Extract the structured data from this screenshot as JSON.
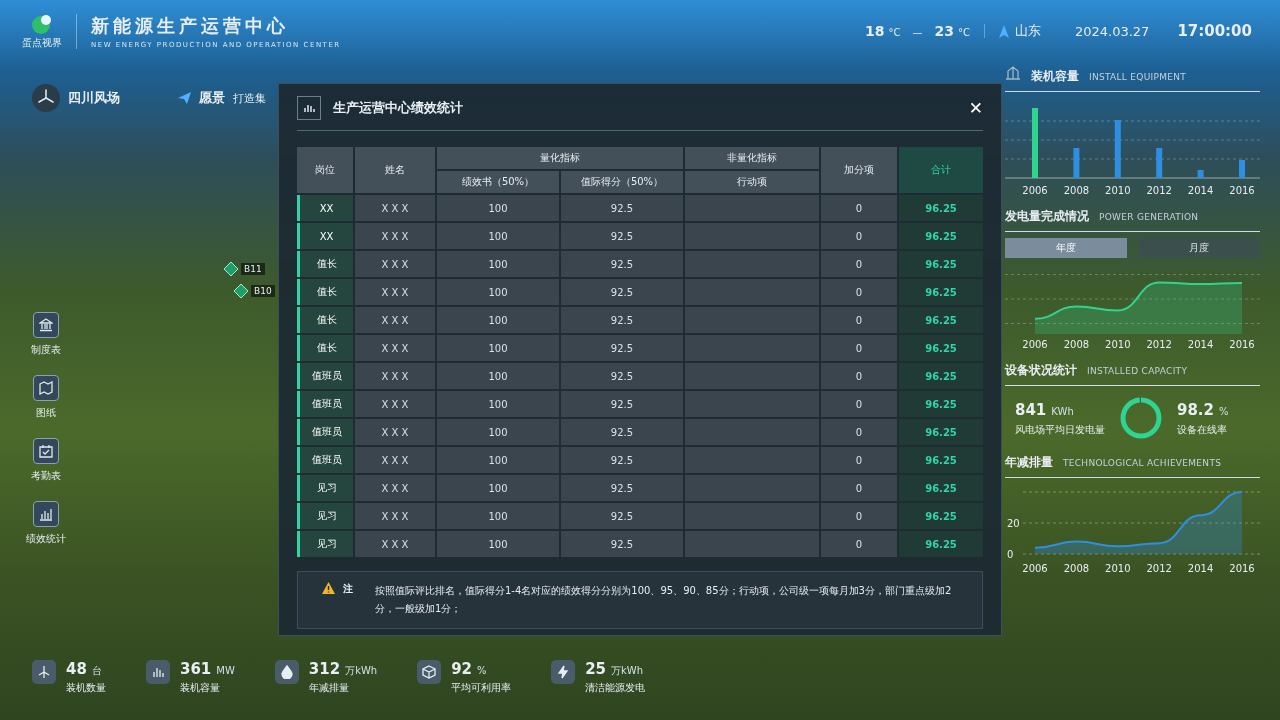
{
  "header": {
    "title": "新能源生产运营中心",
    "subtitle": "NEW ENERGY PRODUCTION AND OPERATION CENTER",
    "logo_text": "蛋点视界",
    "temp_low": "18",
    "temp_low_unit": "°C",
    "temp_sep": "—",
    "temp_high": "23",
    "temp_high_unit": "°C",
    "location": "山东",
    "date": "2024.03.27",
    "time": "17:00:00"
  },
  "site": {
    "name": "四川风场",
    "vision_label": "愿景",
    "vision_text": "打造集"
  },
  "map_pins": [
    {
      "label": "B11"
    },
    {
      "label": "B10"
    }
  ],
  "nav": [
    {
      "kind": "building",
      "label": "制度表"
    },
    {
      "kind": "map",
      "label": "图纸"
    },
    {
      "kind": "calendar",
      "label": "考勤表"
    },
    {
      "kind": "chart",
      "label": "绩效统计"
    }
  ],
  "stats": [
    {
      "kind": "turbine",
      "value": "48",
      "unit": "台",
      "label": "装机数量"
    },
    {
      "kind": "bars",
      "value": "361",
      "unit": "MW",
      "label": "装机容量"
    },
    {
      "kind": "drop",
      "value": "312",
      "unit": "万kWh",
      "label": "年减排量"
    },
    {
      "kind": "cube",
      "value": "92",
      "unit": "%",
      "label": "平均可利用率"
    },
    {
      "kind": "bolt",
      "value": "25",
      "unit": "万kWh",
      "label": "清洁能源发电"
    }
  ],
  "right_panel": {
    "install": {
      "title": "装机容量",
      "subtitle": "INSTALL EQUIPMENT",
      "x_labels": [
        "2006",
        "2008",
        "2010",
        "2012",
        "2014",
        "2016"
      ]
    },
    "generation": {
      "title": "发电量完成情况",
      "subtitle": "POWER GENERATION",
      "tabs": [
        {
          "label": "年度",
          "selected": true
        },
        {
          "label": "月度",
          "selected": false
        }
      ],
      "x_labels": [
        "2006",
        "2008",
        "2010",
        "2012",
        "2014",
        "2016"
      ]
    },
    "equipment": {
      "title": "设备状况统计",
      "subtitle": "INSTALLED CAPACITY",
      "daily_value": "841",
      "daily_unit": "KWh",
      "daily_label": "风电场平均日发电量",
      "online_value": "98.2",
      "online_unit": "%",
      "online_label": "设备在线率",
      "online_ring": {
        "level": 0.982
      }
    },
    "reduction": {
      "title": "年减排量",
      "subtitle": "TECHNOLOGICAL ACHIEVEMENTS",
      "chart_data": {
        "type": "area",
        "categories": [
          "2006",
          "2008",
          "2010",
          "2012",
          "2014",
          "2016"
        ],
        "ylim": [
          0,
          40
        ],
        "yticks": [
          0,
          20
        ],
        "series": [
          {
            "color": "#2e8fe0",
            "values": [
              4,
              8,
              5,
              7,
              25,
              40
            ]
          }
        ]
      }
    }
  },
  "modal": {
    "title": "生产运营中心绩效统计",
    "close": "✕",
    "columns": {
      "post": "岗位",
      "name": "姓名",
      "quant": "量化指标",
      "perf": "绩效书（50%）",
      "shift": "值际得分（50%）",
      "nonquant": "非量化指标",
      "action": "行动项",
      "bonus": "加分项",
      "total": "合计"
    },
    "rows": [
      {
        "post": "XX",
        "name": "X X X",
        "perf": "100",
        "shift": "92.5",
        "bonus": "0",
        "total": "96.25"
      },
      {
        "post": "XX",
        "name": "X X X",
        "perf": "100",
        "shift": "92.5",
        "bonus": "0",
        "total": "96.25"
      },
      {
        "post": "值长",
        "name": "X X X",
        "perf": "100",
        "shift": "92.5",
        "bonus": "0",
        "total": "96.25"
      },
      {
        "post": "值长",
        "name": "X X X",
        "perf": "100",
        "shift": "92.5",
        "bonus": "0",
        "total": "96.25"
      },
      {
        "post": "值长",
        "name": "X X X",
        "perf": "100",
        "shift": "92.5",
        "bonus": "0",
        "total": "96.25"
      },
      {
        "post": "值长",
        "name": "X X X",
        "perf": "100",
        "shift": "92.5",
        "bonus": "0",
        "total": "96.25"
      },
      {
        "post": "值班员",
        "name": "X X X",
        "perf": "100",
        "shift": "92.5",
        "bonus": "0",
        "total": "96.25"
      },
      {
        "post": "值班员",
        "name": "X X X",
        "perf": "100",
        "shift": "92.5",
        "bonus": "0",
        "total": "96.25"
      },
      {
        "post": "值班员",
        "name": "X X X",
        "perf": "100",
        "shift": "92.5",
        "bonus": "0",
        "total": "96.25"
      },
      {
        "post": "值班员",
        "name": "X X X",
        "perf": "100",
        "shift": "92.5",
        "bonus": "0",
        "total": "96.25"
      },
      {
        "post": "见习",
        "name": "X X X",
        "perf": "100",
        "shift": "92.5",
        "bonus": "0",
        "total": "96.25"
      },
      {
        "post": "见习",
        "name": "X X X",
        "perf": "100",
        "shift": "92.5",
        "bonus": "0",
        "total": "96.25"
      },
      {
        "post": "见习",
        "name": "X X X",
        "perf": "100",
        "shift": "92.5",
        "bonus": "0",
        "total": "96.25"
      }
    ],
    "note_label": "注",
    "note": "按照值际评比排名，值际得分1-4名对应的绩效得分分别为100、95、90、85分；行动项，公司级一项每月加3分，部门重点级加2分，一般级加1分；"
  }
}
